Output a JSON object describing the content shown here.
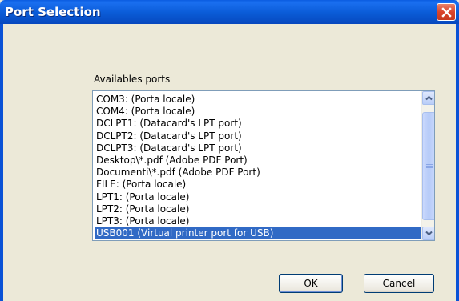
{
  "window": {
    "title": "Port Selection"
  },
  "ports": {
    "label": "Availables ports",
    "items": [
      "COM3:  (Porta locale)",
      "COM4:  (Porta locale)",
      "DCLPT1:  (Datacard's LPT port)",
      "DCLPT2:  (Datacard's LPT port)",
      "DCLPT3:  (Datacard's LPT port)",
      "Desktop\\*.pdf  (Adobe PDF Port)",
      "Documenti\\*.pdf  (Adobe PDF Port)",
      "FILE:  (Porta locale)",
      "LPT1:  (Porta locale)",
      "LPT2:  (Porta locale)",
      "LPT3:  (Porta locale)",
      "USB001  (Virtual printer port for USB)"
    ],
    "selected_index": 11
  },
  "buttons": {
    "ok": "OK",
    "cancel": "Cancel"
  },
  "colors": {
    "titlebar": "#0a5bd6",
    "selection": "#316ac5",
    "dialog_bg": "#ece9d8"
  },
  "icons": {
    "close": "close-icon",
    "scroll_up": "chevron-up-icon",
    "scroll_down": "chevron-down-icon"
  }
}
